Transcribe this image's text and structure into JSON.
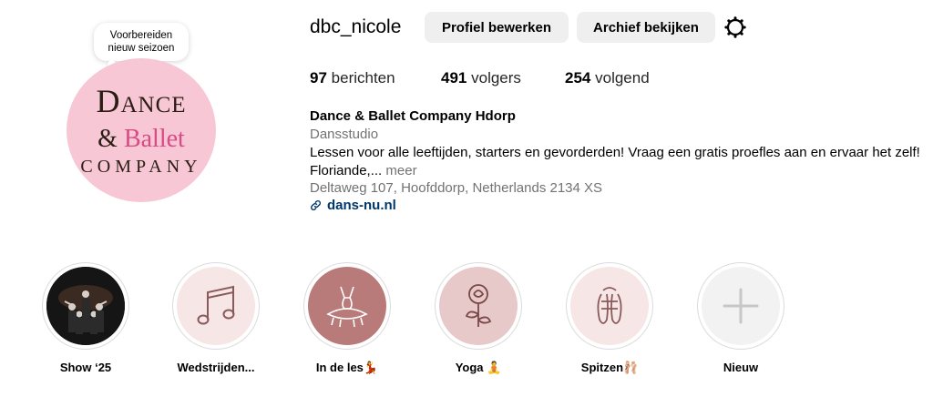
{
  "profile": {
    "note_line1": "Voorbereiden",
    "note_line2": "nieuw seizoen",
    "logo_line1": "Dance",
    "logo_amp": "&",
    "logo_ballet": "Ballet",
    "logo_line3": "COMPANY",
    "username": "dbc_nicole",
    "edit_button": "Profiel bewerken",
    "archive_button": "Archief bekijken"
  },
  "stats": {
    "posts_count": "97",
    "posts_label": "berichten",
    "followers_count": "491",
    "followers_label": "volgers",
    "following_count": "254",
    "following_label": "volgend"
  },
  "bio": {
    "name": "Dance & Ballet Company Hdorp",
    "category": "Dansstudio",
    "text": "Lessen voor alle leeftijden, starters en gevorderden! Vraag een gratis proefles aan en ervaar het zelf! Floriande,...",
    "more": "meer",
    "address": "Deltaweg 107, Hoofddorp, Netherlands 2134 XS",
    "link": "dans-nu.nl"
  },
  "highlights": [
    {
      "label": "Show ‘25",
      "icon": "show-photo",
      "bg": "#1a1a1a"
    },
    {
      "label": "Wedstrijden...",
      "icon": "music-note-icon",
      "bg": "#f7e6e6"
    },
    {
      "label": "In de les💃",
      "icon": "tutu-icon",
      "bg": "#b97a7a"
    },
    {
      "label": "Yoga 🧘",
      "icon": "rose-icon",
      "bg": "#e7c9c9"
    },
    {
      "label": "Spitzen🩰",
      "icon": "pointe-shoes-icon",
      "bg": "#f7e6e6"
    },
    {
      "label": "Nieuw",
      "icon": "plus-icon",
      "bg": "#f2f2f2"
    }
  ],
  "colors": {
    "avatar_bg": "#f7c7d6",
    "link": "#00376b",
    "secondary_text": "#737373",
    "button_bg": "#efefef"
  }
}
